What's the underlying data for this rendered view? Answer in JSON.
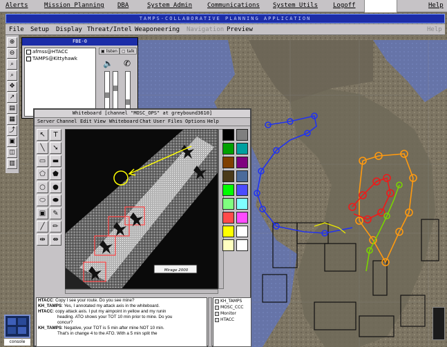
{
  "global_menu": {
    "items": [
      "Alerts",
      "Mission Planning",
      "DBA",
      "System Admin",
      "Communications",
      "System Utils",
      "Logoff"
    ],
    "help": "Help"
  },
  "app": {
    "title": "TAMPS-COLLABORATIVE PLANNING APPLICATION",
    "menu": [
      "File",
      "Setup",
      "Display",
      "Threat/Intel",
      "Weaponeering"
    ],
    "menu_dim": [
      "Navigation",
      "Preview"
    ],
    "help": "Help"
  },
  "left_toolbar": {
    "icons": [
      "zoom-in-icon",
      "zoom-out-icon",
      "zoom-area-icon",
      "zoom-reset-icon",
      "pan-icon",
      "measure-icon",
      "layer-icon",
      "info-icon",
      "route-icon",
      "threat-icon",
      "overlay-icon",
      "grid-icon",
      "print-icon",
      "save-icon",
      "exit-icon"
    ]
  },
  "fbe": {
    "title": "FBE-0",
    "users": [
      "afmss@HTACC",
      "TAMPS@Kittyhawk"
    ],
    "listen_label": "listen",
    "talk_label": "talk"
  },
  "whiteboard": {
    "title": "Whiteboard [channel \"MOSC_OPS\" at greybound3610]",
    "menu": [
      "Server",
      "Channel",
      "Edit",
      "View",
      "Whiteboard",
      "Chat",
      "User",
      "Files",
      "Options",
      "Help"
    ],
    "image_caption": "Mirage 2000",
    "palette": [
      "#000000",
      "#7f7f7f",
      "#00a000",
      "#00a0a0",
      "#7f3f00",
      "#7f007f",
      "#4a3a1a",
      "#4b6b9b",
      "#00ff00",
      "#4b4bff",
      "#7fff7f",
      "#7fffff",
      "#ff4b4b",
      "#ff4bff",
      "#ffff00",
      "#ffffff",
      "#ffffc0",
      "#ffffff"
    ],
    "chat": [
      {
        "who": "HTACC",
        "text": "Copy I see your route. Do you see mine?"
      },
      {
        "who": "KH_TAMPS",
        "text": "Yes, I annotated my attack axis in the whiteboard."
      },
      {
        "who": "HTACC",
        "text": "copy attack axis. I put my aimpoint in yellow and my runin"
      },
      {
        "who": "",
        "text": "heading. ATO shows your TOT 10 min prior to mine. Do you"
      },
      {
        "who": "",
        "text": "concur?"
      },
      {
        "who": "KH_TAMPS",
        "text": "Negative, your TOT is 5 min after mine NOT 10 min."
      },
      {
        "who": "",
        "text": "That's in change 4 to the ATO. With a 5 min split the"
      }
    ],
    "users": [
      "KH_TAMPS",
      "MOSC_CCC",
      "Monitor",
      "HTACC"
    ]
  },
  "console_label": "console",
  "map_colors": {
    "blue_route": "#2233ee",
    "orange_route": "#ff9a10",
    "red_route": "#ee1a1a",
    "green_route": "#7ad400",
    "yellow_route": "#e8e800"
  }
}
